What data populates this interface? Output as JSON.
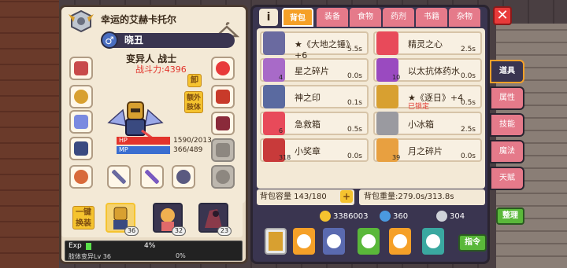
{
  "character": {
    "title": "幸运的艾赫卡托尔",
    "name": "晓丑",
    "gender_icon": "male-icon",
    "race_class": "变异人 战士",
    "power": "战斗力:4396",
    "hp_label": "HP",
    "hp_value": "1590/2013",
    "mp_label": "MP",
    "mp_value": "366/489",
    "unequip_label": "卸",
    "extra_limb_label": "额外肢体"
  },
  "party": {
    "swap_label": "一键换装",
    "members": [
      {
        "level": "36",
        "selected": true
      },
      {
        "level": "32",
        "selected": false
      },
      {
        "level": "23",
        "selected": false
      }
    ]
  },
  "exp": {
    "label": "Exp",
    "percent_text": "4%",
    "progress": 0.04,
    "sub_label": "肢体变异Lv 36",
    "sub_percent": "0%"
  },
  "tabs": [
    "背包",
    "装备",
    "食物",
    "药剂",
    "书籍",
    "杂物"
  ],
  "active_tab": 0,
  "items": [
    {
      "name": "★《大地之锤》+6",
      "time": "5.5s",
      "color": "#6a6aa0"
    },
    {
      "name": "精灵之心",
      "time": "2.5s",
      "color": "#e84a5a"
    },
    {
      "name": "星之碎片",
      "time": "0.0s",
      "count": "4",
      "color": "#a86ac8"
    },
    {
      "name": "以太抗体药水",
      "time": "0.0s",
      "count": "10",
      "color": "#9a4ac0"
    },
    {
      "name": "神之印",
      "time": "0.1s",
      "color": "#5a6aa0"
    },
    {
      "name": "★《逐日》+4",
      "time": "0.5s",
      "locked": "已锁定",
      "color": "#d8a030"
    },
    {
      "name": "急救箱",
      "time": "0.5s",
      "count": "6",
      "color": "#e84a5a"
    },
    {
      "name": "小冰箱",
      "time": "2.5s",
      "color": "#9a9aa0"
    },
    {
      "name": "小奖章",
      "time": "0.0s",
      "count": "318",
      "color": "#c83a3a"
    },
    {
      "name": "月之碎片",
      "time": "0.0s",
      "count": "39",
      "color": "#e8a040"
    }
  ],
  "bag": {
    "capacity": "背包容量 143/180",
    "weight": "背包重量:279.0s/313.8s"
  },
  "currency": {
    "gold": "3386003",
    "gem": "360",
    "silver": "304"
  },
  "buttons": {
    "sort": "整理",
    "command": "指令"
  },
  "side_tabs": [
    "道具",
    "属性",
    "技能",
    "魔法",
    "天赋"
  ],
  "active_side_tab": 0,
  "info_label": "i",
  "close_icon": "close-icon"
}
